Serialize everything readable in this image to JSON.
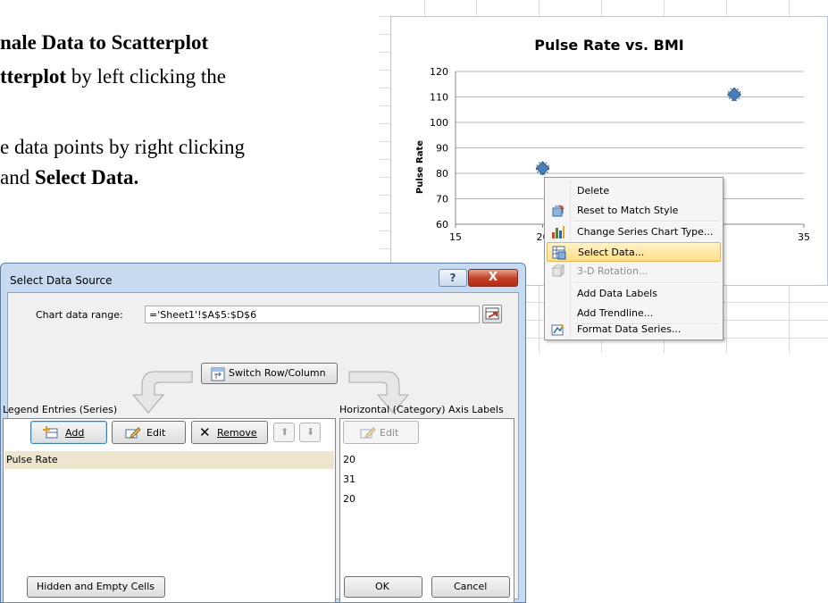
{
  "doc": {
    "line1": "nale Data to Scatterplot",
    "line2_bold": "tterplot",
    "line2_rest": " by left clicking the",
    "line3": "e data points by right clicking",
    "line4_pre": "and ",
    "line4_bold": "Select Data."
  },
  "chart": {
    "title": "Pulse Rate vs. BMI",
    "ylabel": "Pulse Rate",
    "y_ticks": [
      "120",
      "110",
      "100",
      "90",
      "80",
      "70",
      "60"
    ],
    "x_ticks": [
      "15",
      "20",
      "35"
    ]
  },
  "chart_data": {
    "type": "scatter",
    "title": "Pulse Rate vs. BMI",
    "xlabel": "",
    "ylabel": "Pulse Rate",
    "xlim": [
      15,
      35
    ],
    "ylim": [
      60,
      120
    ],
    "grid": true,
    "series": [
      {
        "name": "Pulse Rate",
        "points": [
          {
            "x": 20,
            "y": 82
          },
          {
            "x": 31,
            "y": 111
          }
        ]
      }
    ]
  },
  "context_menu": {
    "items": [
      {
        "label": "Delete",
        "icon": "none"
      },
      {
        "label": "Reset to Match Style",
        "icon": "reset-style-icon"
      },
      {
        "label": "Change Series Chart Type...",
        "icon": "chart-type-icon"
      },
      {
        "label": "Select Data...",
        "icon": "select-data-icon"
      },
      {
        "label": "3-D Rotation...",
        "icon": "rotation-icon"
      },
      {
        "label": "Add Data Labels",
        "icon": "none"
      },
      {
        "label": "Add Trendline...",
        "icon": "none"
      },
      {
        "label": "Format Data Series...",
        "icon": "format-series-icon"
      }
    ]
  },
  "dialog": {
    "title": "Select Data Source",
    "help": "?",
    "close": "X",
    "range_label": "Chart data range:",
    "range_value": "='Sheet1'!$A$5:$D$6",
    "switch_label": "Switch Row/Column",
    "legend_header": "Legend Entries (Series)",
    "axis_header": "Horizontal (Category) Axis Labels",
    "add_label": "Add",
    "edit_label": "Edit",
    "remove_label": "Remove",
    "axis_edit_label": "Edit",
    "series": [
      "Pulse Rate"
    ],
    "categories": [
      "20",
      "31",
      "20"
    ],
    "hidden_label": "Hidden and Empty Cells",
    "ok_label": "OK",
    "cancel_label": "Cancel"
  },
  "colors": {
    "accent_highlight": "#ffdf87",
    "dialog_frame": "#c7daf0",
    "close_red": "#c3432a",
    "marker": "#4a7ebb"
  }
}
